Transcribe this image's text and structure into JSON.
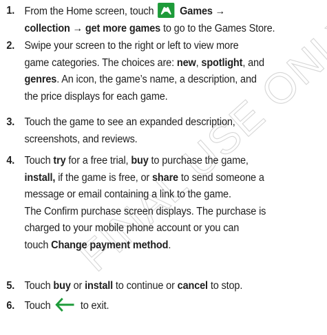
{
  "watermark": "FINAL USE ONLY",
  "steps": [
    {
      "num": "1.",
      "lines": [
        {
          "a": "From the Home screen, touch ",
          "icon": "games-icon",
          "b": " Games →"
        },
        {
          "a": "collection → get more games",
          "b": " to go to the Games Store."
        }
      ]
    },
    {
      "num": "2.",
      "lines": [
        {
          "a": "Swipe your screen to the right or left to view more"
        },
        {
          "a": "game categories. The choices are: ",
          "b1": "new",
          "c": ", ",
          "b2": "spotlight",
          "d": ", and"
        },
        {
          "b": "genres",
          "a": ". An icon, the game’s name, a description, and"
        },
        {
          "a": "the price displays for each game."
        }
      ]
    },
    {
      "num": "3.",
      "lines": [
        {
          "a": "Touch the game to see an expanded description,"
        },
        {
          "a": "screenshots, and reviews."
        }
      ]
    },
    {
      "num": "4.",
      "lines": [
        {
          "a": "Touch ",
          "b1": "try",
          "c": " for a free trial, ",
          "b2": "buy",
          "d": " to purchase the game,"
        },
        {
          "b": "install,",
          "a": " if the game is free, or ",
          "b2": "share",
          "c": " to send someone a"
        },
        {
          "a": "message or email containing a link to the game."
        },
        {
          "a": "The Confirm purchase screen displays. The purchase is"
        },
        {
          "a": "charged to your mobile phone account or you can"
        },
        {
          "a": "touch ",
          "b": "Change payment method",
          "c": "."
        }
      ]
    },
    {
      "num": "5.",
      "lines": [
        {
          "a": "Touch ",
          "b1": "buy",
          "c": " or ",
          "b2": "install",
          "d": " to continue or ",
          "b3": "cancel",
          "e": " to stop."
        }
      ]
    },
    {
      "num": "6.",
      "lines": [
        {
          "a": "Touch ",
          "icon": "back-arrow-icon",
          "b": " to exit."
        }
      ]
    }
  ],
  "colors": {
    "text": "#1f1f1f",
    "games_icon_bg": "#1e9b3a",
    "back_arrow": "#1e9b3a",
    "watermark": "#d6d6d6"
  }
}
